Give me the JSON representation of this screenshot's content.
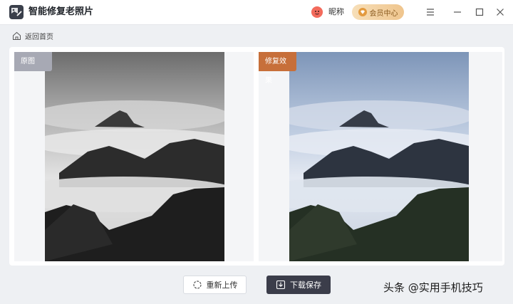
{
  "app": {
    "title": "智能修复老照片"
  },
  "header": {
    "nickname": "昵称",
    "vip_label": "会员中心"
  },
  "nav": {
    "back_label": "返回首页"
  },
  "compare": {
    "original_label": "原图",
    "restored_label": "修复效果"
  },
  "actions": {
    "reupload_label": "重新上传",
    "save_label": "下载保存"
  },
  "watermark": "头条 @实用手机技巧",
  "colors": {
    "accent_tag": "#c76f3a",
    "original_tag": "#a7a9b4",
    "save_button": "#3b3d4a",
    "vip_gold": "#efc58d"
  },
  "icons": [
    "app-logo-icon",
    "avatar-icon",
    "diamond-icon",
    "menu-icon",
    "minimize-icon",
    "maximize-icon",
    "close-icon",
    "home-icon",
    "refresh-icon",
    "download-icon"
  ]
}
